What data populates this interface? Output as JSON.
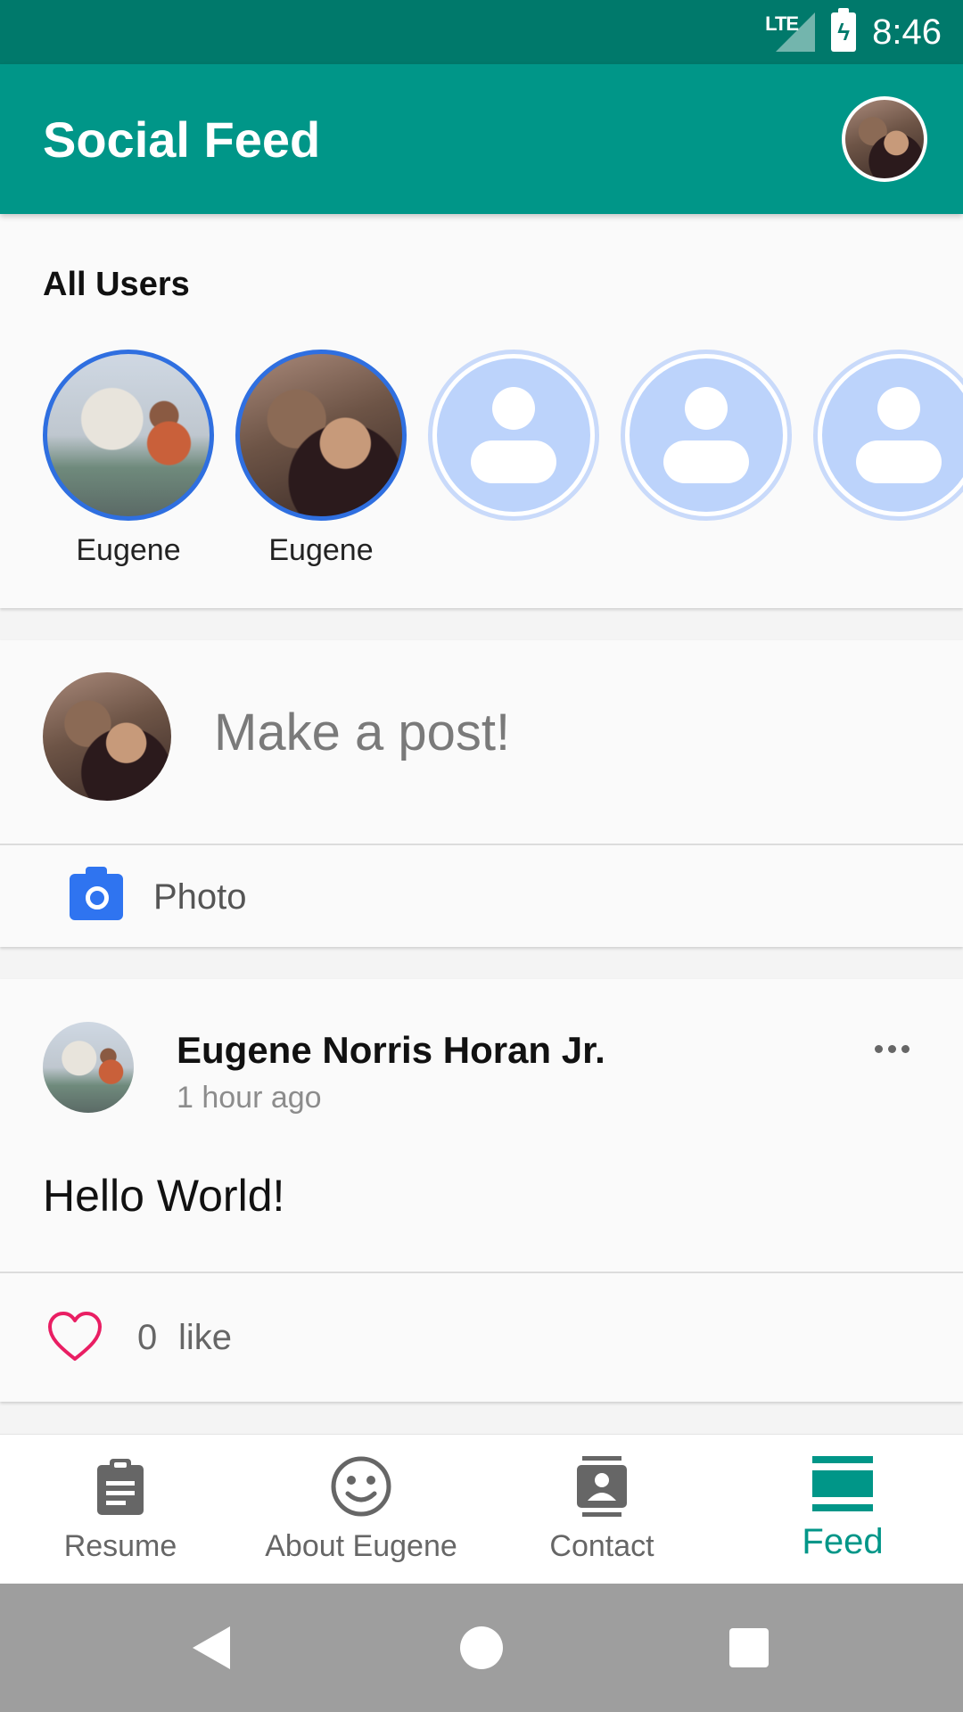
{
  "status_bar": {
    "network": "LTE",
    "time": "8:46"
  },
  "app_bar": {
    "title": "Social Feed"
  },
  "users_section": {
    "heading": "All Users",
    "users": [
      {
        "name": "Eugene",
        "has_photo": true
      },
      {
        "name": "Eugene",
        "has_photo": true
      },
      {
        "name": "",
        "has_photo": false
      },
      {
        "name": "",
        "has_photo": false
      },
      {
        "name": "",
        "has_photo": false
      }
    ]
  },
  "composer": {
    "placeholder": "Make a post!",
    "photo_label": "Photo"
  },
  "post": {
    "author": "Eugene Norris Horan Jr.",
    "time": "1 hour ago",
    "body": "Hello World!",
    "like_count": "0",
    "like_label": "like"
  },
  "bottom_nav": {
    "items": [
      {
        "label": "Resume",
        "icon": "clipboard-icon",
        "active": false
      },
      {
        "label": "About Eugene",
        "icon": "smiley-icon",
        "active": false
      },
      {
        "label": "Contact",
        "icon": "contact-card-icon",
        "active": false
      },
      {
        "label": "Feed",
        "icon": "feed-icon",
        "active": true
      }
    ]
  },
  "colors": {
    "status_bar": "#00796b",
    "app_bar": "#009688",
    "user_ring": "#2f6fe0",
    "placeholder_fill": "#bcd3fb",
    "camera": "#2f74f0",
    "heart": "#e91e63",
    "nav_active": "#009688",
    "system_nav": "#9e9e9e"
  }
}
